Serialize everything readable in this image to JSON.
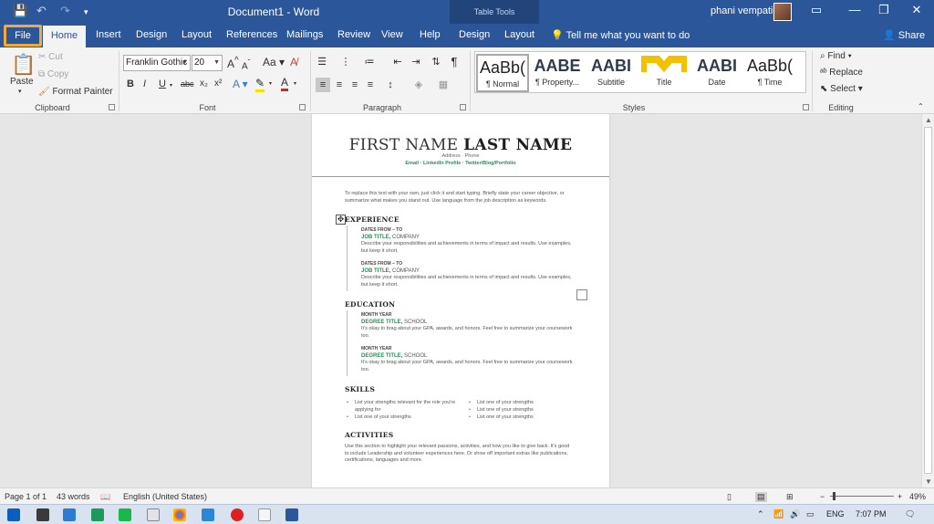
{
  "window": {
    "title": "Document1  -  Word",
    "context_label": "Table Tools",
    "user_name": "phani vempati",
    "controls": {
      "ribbon_display": "▭",
      "minimize": "—",
      "restore": "❐",
      "close": "✕"
    },
    "qa_save": "💾",
    "qa_undo": "↶",
    "qa_redo": "↷",
    "qa_customize": "▾"
  },
  "tabs": {
    "file": "File",
    "home": "Home",
    "insert": "Insert",
    "design": "Design",
    "layout": "Layout",
    "references": "References",
    "mailings": "Mailings",
    "review": "Review",
    "view": "View",
    "help": "Help",
    "table_design": "Design",
    "table_layout": "Layout",
    "tell_me": "Tell me what you want to do",
    "share": "Share"
  },
  "clipboard": {
    "paste": "Paste",
    "cut": "Cut",
    "copy": "Copy",
    "format_painter": "Format Painter",
    "label": "Clipboard"
  },
  "font": {
    "name": "Franklin Gothic",
    "size": "20",
    "grow": "A",
    "shrink": "A",
    "case": "Aa",
    "label": "Font",
    "bold": "B",
    "italic": "I",
    "underline": "U",
    "strike": "abc",
    "sub": "x₂",
    "sup": "x²",
    "color": "A"
  },
  "paragraph": {
    "label": "Paragraph",
    "pilcrow": "¶"
  },
  "styles": {
    "label": "Styles",
    "items": [
      {
        "sample": "AaBb(",
        "name": "¶ Normal"
      },
      {
        "sample": "AABE",
        "name": "¶ Property..."
      },
      {
        "sample": "AABI",
        "name": "Subtitle"
      },
      {
        "sample": "",
        "name": "Title"
      },
      {
        "sample": "AABI",
        "name": "Date"
      },
      {
        "sample": "AaBb(",
        "name": "¶ Time"
      }
    ]
  },
  "editing": {
    "find": "Find",
    "replace": "Replace",
    "select": "Select",
    "label": "Editing"
  },
  "document": {
    "first_name": "FIRST NAME",
    "last_name": "LAST NAME",
    "contact_line1": "Address · Phone",
    "contact_line2": "Email · LinkedIn Profile · Twitter/Blog/Portfolio",
    "objective": "To replace this text with your own, just click it and start typing. Briefly state your career objective, or summarize what makes you stand out. Use language from the job description as keywords.",
    "experience_heading": "EXPERIENCE",
    "experience": [
      {
        "dates": "DATES FROM – TO",
        "title": "JOB TITLE,",
        "org": " COMPANY",
        "desc": "Describe your responsibilities and achievements in terms of impact and results. Use examples, but keep it short."
      },
      {
        "dates": "DATES FROM – TO",
        "title": "JOB TITLE,",
        "org": " COMPANY",
        "desc": "Describe your responsibilities and achievements in terms of impact and results. Use examples, but keep it short."
      }
    ],
    "education_heading": "EDUCATION",
    "education": [
      {
        "dates": "MONTH YEAR",
        "title": "DEGREE TITLE,",
        "org": " SCHOOL",
        "desc": "It's okay to brag about your GPA, awards, and honors. Feel free to summarize your coursework too."
      },
      {
        "dates": "MONTH YEAR",
        "title": "DEGREE TITLE,",
        "org": " SCHOOL",
        "desc": "It's okay to brag about your GPA, awards, and honors. Feel free to summarize your coursework too."
      }
    ],
    "skills_heading": "SKILLS",
    "skills_left": [
      "List your strengths relevant for the role you're applying for",
      "List one of your strengths"
    ],
    "skills_right": [
      "List one of your strengths",
      "List one of your strengths",
      "List one of your strengths"
    ],
    "activities_heading": "ACTIVITIES",
    "activities": "Use this section to highlight your relevant passions, activities, and how you like to give back. It's good to include Leadership and volunteer experiences here. Or show off important extras like publications, certifications, languages and more."
  },
  "status": {
    "page": "Page 1 of 1",
    "words": "43 words",
    "language": "English (United States)",
    "zoom": "49%",
    "zoom_minus": "−",
    "zoom_plus": "+"
  },
  "taskbar": {
    "lang": "ENG",
    "time": "7:07 PM"
  },
  "colors": {
    "word_blue": "#2b579a",
    "accent_green": "#2e8b57",
    "file_highlight": "#f3a83a"
  }
}
